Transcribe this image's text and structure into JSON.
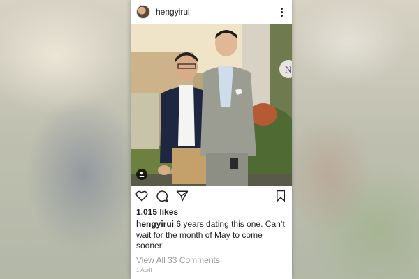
{
  "post": {
    "username": "hengyirui",
    "likes": "1,015 likes",
    "caption_user": "hengyirui",
    "caption_text": "6 years dating this one. Can’t wait for the month of May to come sooner!",
    "view_comments": "View All 33 Comments",
    "date": "1 April",
    "photo_badge_letter": "N"
  },
  "icons": {
    "more": "more-options-icon",
    "heart": "heart-icon",
    "comment": "comment-icon",
    "share": "share-icon",
    "bookmark": "bookmark-icon",
    "user_tag": "user-tag-icon"
  }
}
